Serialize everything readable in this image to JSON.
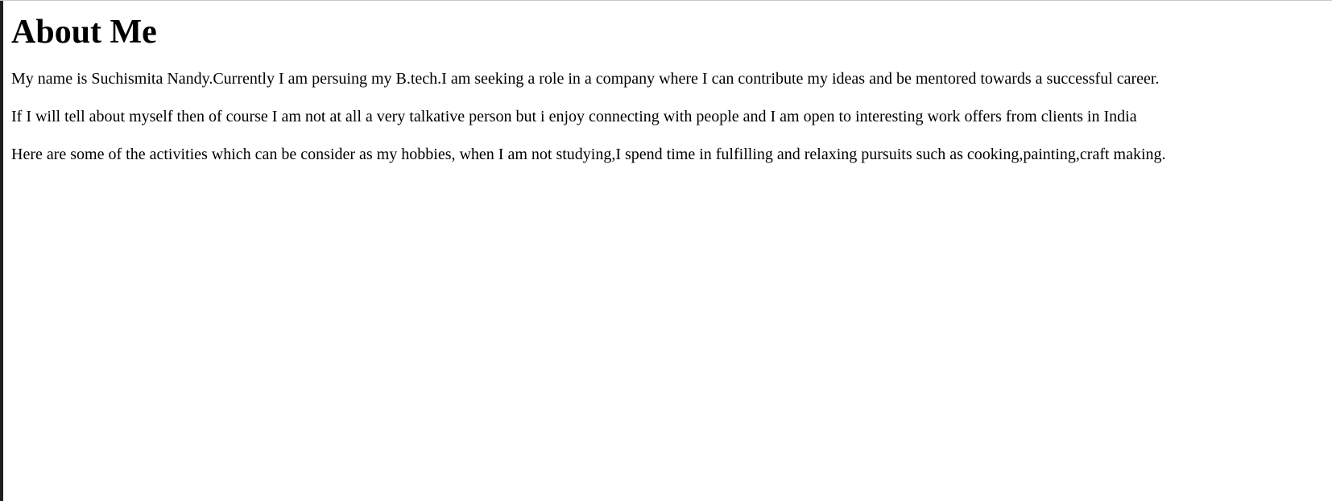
{
  "page": {
    "title": "About Me",
    "paragraphs": [
      "My name is Suchismita Nandy.Currently I am persuing my B.tech.I am seeking a role in a company where I can contribute my ideas and be mentored towards a successful career.",
      "If I will tell about myself then of course I am not at all a very talkative person but i enjoy connecting with people and I am open to interesting work offers from clients in India",
      "Here are some of the activities which can be consider as my hobbies, when I am not studying,I spend time in fulfilling and relaxing pursuits such as cooking,painting,craft making."
    ]
  },
  "colors": {
    "background": "#ffffff",
    "text": "#000000",
    "left_edge": "#1e1e1e"
  }
}
